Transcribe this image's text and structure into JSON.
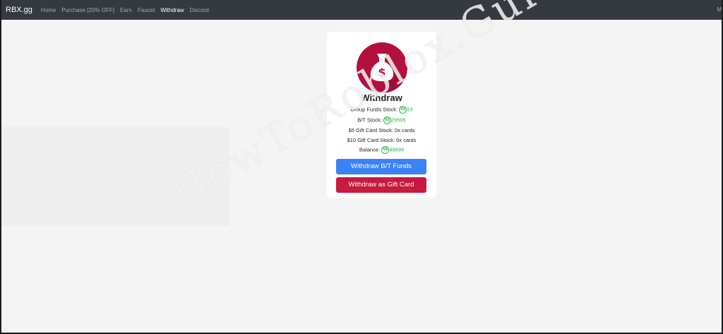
{
  "navbar": {
    "brand": "RBX.gg",
    "links": [
      "Home",
      "Purchase [20% OFF]",
      "Earn",
      "Faucet",
      "Withdraw",
      "Discord"
    ],
    "active": "Withdraw",
    "right_text": "M"
  },
  "card": {
    "icon": "money-bag-icon",
    "title": "Withdraw",
    "currency_symbol": "R$",
    "stats": {
      "group_funds": {
        "label": "Group Funds Stock:",
        "value": "53"
      },
      "bt_stock": {
        "label": "B/T Stock:",
        "value": "29595"
      },
      "gift5": {
        "label": "$5 Gift Card Stock:",
        "value": "0x cards"
      },
      "gift10": {
        "label": "$10 Gift Card Stock:",
        "value": "0x cards"
      },
      "balance": {
        "label": "Balance:",
        "value": "99999"
      }
    },
    "buttons": {
      "withdraw_bt": "Withdraw B/T Funds",
      "withdraw_gift": "Withdraw as Gift Card"
    }
  },
  "watermark": "HowToRoblox.Guide",
  "colors": {
    "navbar": "#343a40",
    "primary_button": "#3b82f6",
    "danger_button": "#c8193f",
    "logo_circle": "#b3103d",
    "robux_green": "#2cb34a"
  }
}
